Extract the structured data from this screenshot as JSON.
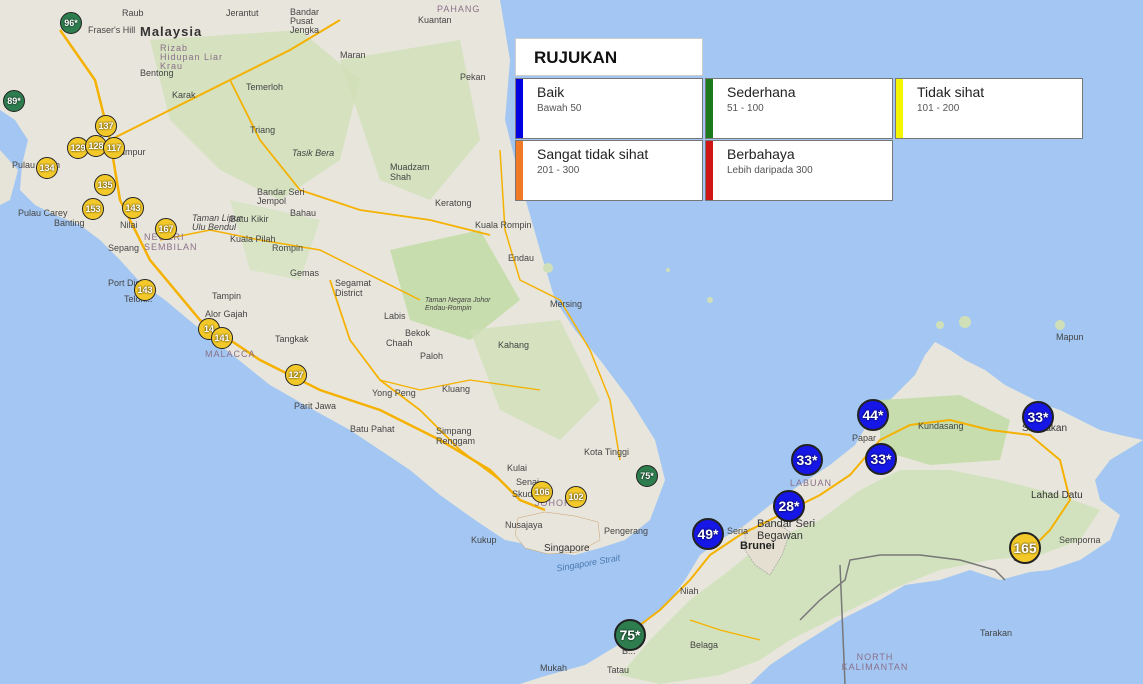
{
  "legend": {
    "title": "RUJUKAN",
    "categories": [
      {
        "name": "Baik",
        "range": "Bawah 50",
        "color": "#0000e0"
      },
      {
        "name": "Sederhana",
        "range": "51 - 100",
        "color": "#1b7a1b"
      },
      {
        "name": "Tidak sihat",
        "range": "101 - 200",
        "color": "#f5f500"
      },
      {
        "name": "Sangat tidak sihat",
        "range": "201 - 300",
        "color": "#f07a25"
      },
      {
        "name": "Berbahaya",
        "range": "Lebih daripada 300",
        "color": "#d01515"
      }
    ]
  },
  "places": {
    "malaysia": "Malaysia",
    "rizab": "Rizab Hidupan Liar Krau",
    "raub": "Raub",
    "fraser": "Fraser's Hill",
    "bentong": "Bentong",
    "karak": "Karak",
    "temerloh": "Temerloh",
    "triang": "Triang",
    "kl": "Lumpur",
    "pulau_indah": "Pulau Indah",
    "pulau_carey": "Pulau Carey",
    "banting": "Banting",
    "sepang": "Sepang",
    "nilai": "Nilai",
    "port_dickson": "Port Dick...",
    "telok": "Telok...",
    "negeri": "NEGERI SEMBILAN",
    "kuala_pilah": "Kuala Pilah",
    "bahau": "Bahau",
    "bandar_seri_jempol": "Bandar Seri Jempol",
    "taman_lipur": "Taman Lipur Ulu Bendul",
    "batu_kikir": "Batu Kikir",
    "rompin": "Rompin",
    "gemas": "Gemas",
    "tampin": "Tampin",
    "alor_gajah": "Alor Gajah",
    "malacca": "MALACCA",
    "tangkak": "Tangkak",
    "segamat": "Segamat District",
    "labis": "Labis",
    "bekok": "Bekok",
    "chaah": "Chaah",
    "paloh": "Paloh",
    "kluang": "Kluang",
    "yong_peng": "Yong Peng",
    "batu_pahat": "Batu Pahat",
    "parit_jawa": "Parit Jawa",
    "simpang_renggam": "Simpang Renggam",
    "kulai": "Kulai",
    "senai": "Senai",
    "skudai": "Skudai",
    "nusajaya": "Nusajaya",
    "johor": "JOHOR",
    "kukup": "Kukup",
    "singapore": "Singapore",
    "singapore_strait": "Singapore Strait",
    "pengerang": "Pengerang",
    "kota_tinggi": "Kota Tinggi",
    "mersing": "Mersing",
    "endau": "Endau",
    "kuala_rompin": "Kuala Rompin",
    "kahang": "Kahang",
    "taman_negara": "Taman Negara Johor Endau-Rompin",
    "pekan": "Pekan",
    "pahang": "PAHANG",
    "kuantan": "Kuantan",
    "bandar_pusat": "Bandar Pusat Jengka",
    "jerantut": "Jerantut",
    "maran": "Maran",
    "muadzam": "Muadzam Shah",
    "tasik_bera": "Tasik Bera",
    "keratong": "Keratong",
    "mapun": "Mapun",
    "kundasang": "Kundasang",
    "sandakan": "Sandakan",
    "lahad_datu": "Lahad Datu",
    "semporna": "Semporna",
    "tawau": "T...",
    "papar": "Papar",
    "labuan": "LABUAN",
    "brunei": "Brunei",
    "bandar": "Bandar Seri Begawan",
    "seria": "Seria",
    "niah": "Niah",
    "belaga": "Belaga",
    "mukah": "Mukah",
    "tatau": "Tatau",
    "bintulu": "B...",
    "north_kalimantan": "NORTH KALIMANTAN",
    "tarakan": "Tarakan"
  },
  "markers": [
    {
      "label": "96*",
      "level": "moderate"
    },
    {
      "label": "89*",
      "level": "moderate"
    },
    {
      "label": "137",
      "level": "unhealthy"
    },
    {
      "label": "129",
      "level": "unhealthy"
    },
    {
      "label": "128",
      "level": "unhealthy"
    },
    {
      "label": "117",
      "level": "unhealthy"
    },
    {
      "label": "134",
      "level": "unhealthy"
    },
    {
      "label": "135",
      "level": "unhealthy"
    },
    {
      "label": "153",
      "level": "unhealthy"
    },
    {
      "label": "143",
      "level": "unhealthy"
    },
    {
      "label": "167",
      "level": "unhealthy"
    },
    {
      "label": "143",
      "level": "unhealthy"
    },
    {
      "label": "14",
      "level": "unhealthy"
    },
    {
      "label": "141",
      "level": "unhealthy"
    },
    {
      "label": "127",
      "level": "unhealthy"
    },
    {
      "label": "106",
      "level": "unhealthy"
    },
    {
      "label": "102",
      "level": "unhealthy"
    },
    {
      "label": "75*",
      "level": "moderate"
    },
    {
      "label": "44*",
      "level": "good"
    },
    {
      "label": "33*",
      "level": "good"
    },
    {
      "label": "33*",
      "level": "good"
    },
    {
      "label": "33*",
      "level": "good"
    },
    {
      "label": "28*",
      "level": "good"
    },
    {
      "label": "49*",
      "level": "good"
    },
    {
      "label": "165",
      "level": "unhealthy"
    },
    {
      "label": "75*",
      "level": "moderate"
    }
  ]
}
